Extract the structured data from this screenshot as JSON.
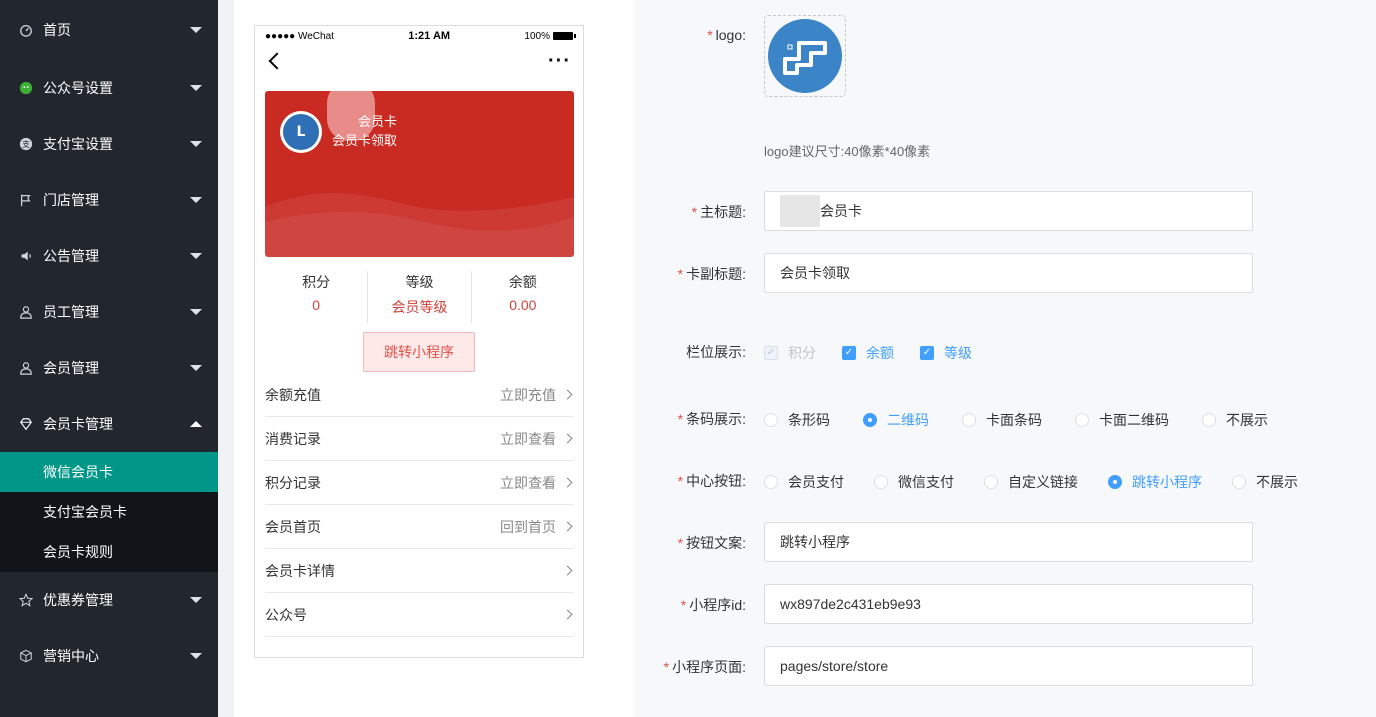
{
  "sidebar": {
    "items": [
      {
        "label": "首页",
        "icon": "dashboard-icon"
      },
      {
        "label": "公众号设置",
        "icon": "wechat-icon"
      },
      {
        "label": "支付宝设置",
        "icon": "alipay-icon"
      },
      {
        "label": "门店管理",
        "icon": "flag-icon"
      },
      {
        "label": "公告管理",
        "icon": "speaker-icon"
      },
      {
        "label": "员工管理",
        "icon": "user-icon"
      },
      {
        "label": "会员管理",
        "icon": "user-icon"
      },
      {
        "label": "会员卡管理",
        "icon": "diamond-icon"
      }
    ],
    "sub_items": [
      {
        "label": "微信会员卡"
      },
      {
        "label": "支付宝会员卡"
      },
      {
        "label": "会员卡规则"
      }
    ],
    "items_after": [
      {
        "label": "优惠券管理",
        "icon": "star-icon"
      },
      {
        "label": "营销中心",
        "icon": "cube-icon"
      }
    ],
    "active_color": "#009688"
  },
  "phone": {
    "status_carrier": "●●●●● WeChat",
    "status_time": "1:21 AM",
    "status_battery": "100%",
    "card": {
      "title": "会员卡",
      "subtitle": "会员卡领取",
      "color": "#c92a22"
    },
    "stats": [
      {
        "label": "积分",
        "value": "0"
      },
      {
        "label": "等级",
        "value": "会员等级"
      },
      {
        "label": "余额",
        "value": "0.00"
      }
    ],
    "jump_button": "跳转小程序",
    "list": [
      {
        "label": "余额充值",
        "action": "立即充值"
      },
      {
        "label": "消费记录",
        "action": "立即查看"
      },
      {
        "label": "积分记录",
        "action": "立即查看"
      },
      {
        "label": "会员首页",
        "action": "回到首页"
      },
      {
        "label": "会员卡详情",
        "action": ""
      },
      {
        "label": "公众号",
        "action": ""
      }
    ]
  },
  "form": {
    "logo_label": "logo:",
    "logo_hint": "logo建议尺寸:40像素*40像素",
    "title_label": "主标题:",
    "title_value": "会员卡",
    "subtitle_label": "卡副标题:",
    "subtitle_value": "会员卡领取",
    "fields_label": "栏位展示:",
    "fields": [
      {
        "label": "积分",
        "state": "disabled"
      },
      {
        "label": "余额",
        "state": "checked"
      },
      {
        "label": "等级",
        "state": "checked"
      }
    ],
    "code_label": "条码展示:",
    "code_options": [
      {
        "label": "条形码",
        "selected": false
      },
      {
        "label": "二维码",
        "selected": true
      },
      {
        "label": "卡面条码",
        "selected": false
      },
      {
        "label": "卡面二维码",
        "selected": false
      },
      {
        "label": "不展示",
        "selected": false
      }
    ],
    "center_label": "中心按钮:",
    "center_options": [
      {
        "label": "会员支付",
        "selected": false
      },
      {
        "label": "微信支付",
        "selected": false
      },
      {
        "label": "自定义链接",
        "selected": false
      },
      {
        "label": "跳转小程序",
        "selected": true
      },
      {
        "label": "不展示",
        "selected": false
      }
    ],
    "btn_text_label": "按钮文案:",
    "btn_text_value": "跳转小程序",
    "appid_label": "小程序id:",
    "appid_value": "wx897de2c431eb9e93",
    "page_label": "小程序页面:",
    "page_value": "pages/store/store",
    "accent": "#409eff",
    "required_color": "#e0524a"
  }
}
